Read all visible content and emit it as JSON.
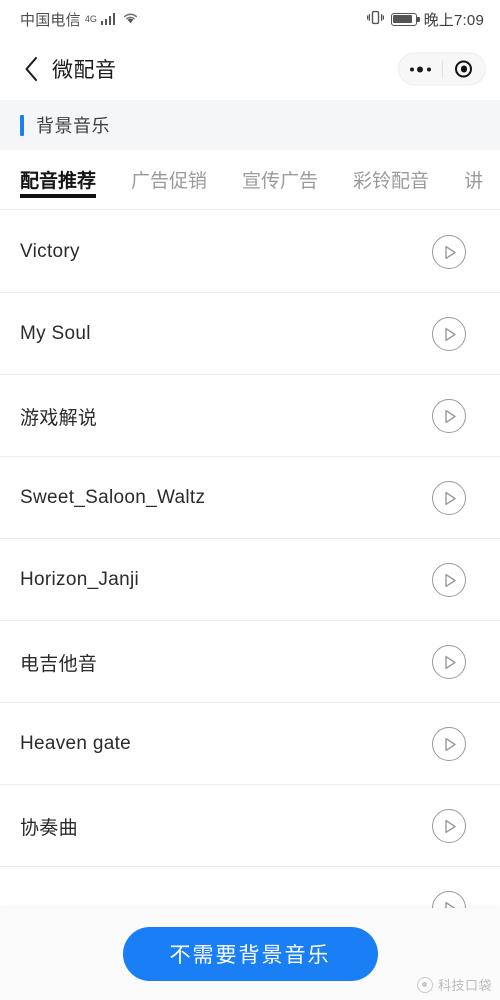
{
  "status_bar": {
    "carrier": "中国电信",
    "network_type": "4G",
    "signal_icon": "signal-bars-icon",
    "wifi_icon": "wifi-icon",
    "vibrate_icon": "vibrate-icon",
    "battery_icon": "battery-icon",
    "battery_level": 88,
    "time": "晚上7:09"
  },
  "nav": {
    "back_icon": "back-chevron-icon",
    "title": "微配音",
    "capsule": {
      "menu_icon": "more-dots-icon",
      "close_icon": "target-circle-icon"
    }
  },
  "section": {
    "title": "背景音乐",
    "accent_color": "#1b7ef2"
  },
  "tabs": [
    {
      "label": "配音推荐",
      "active": true
    },
    {
      "label": "广告促销",
      "active": false
    },
    {
      "label": "宣传广告",
      "active": false
    },
    {
      "label": "彩铃配音",
      "active": false
    },
    {
      "label": "讲",
      "active": false
    }
  ],
  "list": {
    "play_icon": "play-circle-icon",
    "items": [
      {
        "title": "Victory"
      },
      {
        "title": "My Soul"
      },
      {
        "title": "游戏解说"
      },
      {
        "title": "Sweet_Saloon_Waltz"
      },
      {
        "title": "Horizon_Janji"
      },
      {
        "title": "电吉他音"
      },
      {
        "title": "Heaven gate"
      },
      {
        "title": "协奏曲"
      },
      {
        "title": ""
      }
    ]
  },
  "bottom": {
    "cta_label": "不需要背景音乐",
    "cta_color": "#1a7ef5"
  },
  "watermark": {
    "logo_icon": "watermark-logo-icon",
    "text": "科技口袋"
  }
}
